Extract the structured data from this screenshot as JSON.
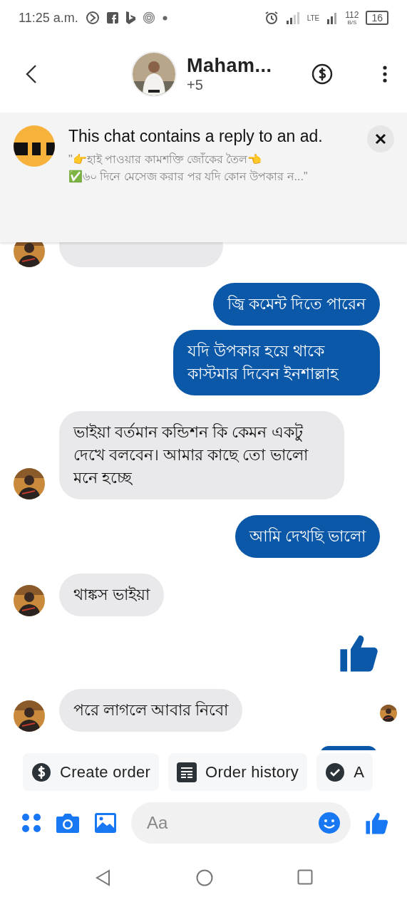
{
  "status_bar": {
    "time": "11:25 a.m.",
    "network": "LTE",
    "speed": "112",
    "speed_unit": "B/S",
    "battery": "16"
  },
  "header": {
    "name": "Maham...",
    "subtitle": "+5"
  },
  "ad_banner": {
    "title": "This chat contains a reply to an ad.",
    "quote": "\"👉হাই পাওয়ার কামশক্তি জোঁকের তৈল👈\n✅৬০ দিনে মেসেজ করার পর যদি কোন উপকার ন...\""
  },
  "messages": [
    {
      "kind": "incoming",
      "seen": false
    },
    {
      "kind": "outgoing",
      "text": "জ্বি কমেন্ট দিতে পারেন",
      "seen": false
    },
    {
      "kind": "outgoing",
      "text": "যদি উপকার হয়ে থাকে কাস্টমার দিবেন ইনশাল্লাহ",
      "seen": false
    },
    {
      "kind": "incoming",
      "text": "ভাইয়া বর্তমান কন্ডিশন কি কেমন একটু দেখে  বলবেন। আমার কাছে তো ভালো মনে হচ্ছে",
      "seen": false
    },
    {
      "kind": "outgoing",
      "text": "আমি দেখছি ভালো",
      "seen": false
    },
    {
      "kind": "incoming",
      "text": "থাঙ্কস ভাইয়া",
      "seen": false
    },
    {
      "kind": "like",
      "seen": false
    },
    {
      "kind": "incoming",
      "text": "পরে লাগলে আবার নিবো",
      "seen": true
    }
  ],
  "quick_actions": [
    {
      "label": "Create order"
    },
    {
      "label": "Order history"
    },
    {
      "label": "A"
    }
  ],
  "composer": {
    "placeholder": "Aa"
  }
}
